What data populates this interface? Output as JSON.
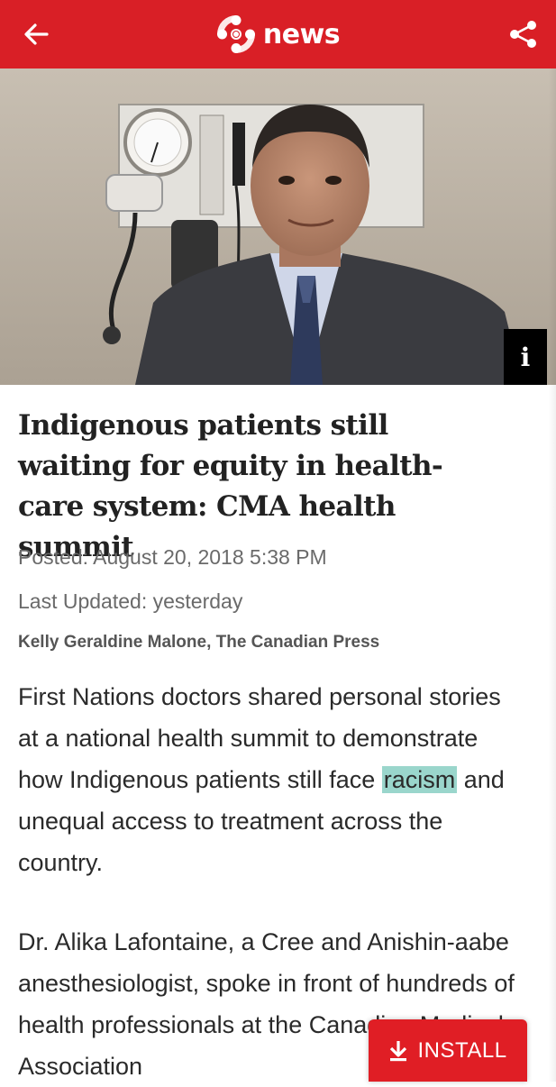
{
  "app": {
    "brand": "news",
    "accent": "#d91f26"
  },
  "icons": {
    "back": "arrow-left-icon",
    "logo": "cbc-gem-logo",
    "share": "share-icon",
    "info": "info-icon",
    "download": "download-icon"
  },
  "hero": {
    "info_label": "i"
  },
  "article": {
    "headline": "Indigenous patients still waiting for equity in health-care system: CMA health summit",
    "posted": "Posted: August 20, 2018 5:38 PM",
    "updated": "Last Updated: yesterday",
    "byline": "Kelly Geraldine Malone, The Canadian Press",
    "para1_before": "First Nations doctors shared personal stories at a national health summit to demonstrate how Indigenous patients still face ",
    "para1_highlight": "racism",
    "para1_after": " and unequal access to treatment across the country.",
    "para2": "Dr. Alika Lafontaine, a Cree and Anishin-aabe anesthesiologist, spoke in front of hundreds of health professionals at the Canadian Medical Association"
  },
  "install": {
    "label": "INSTALL"
  }
}
